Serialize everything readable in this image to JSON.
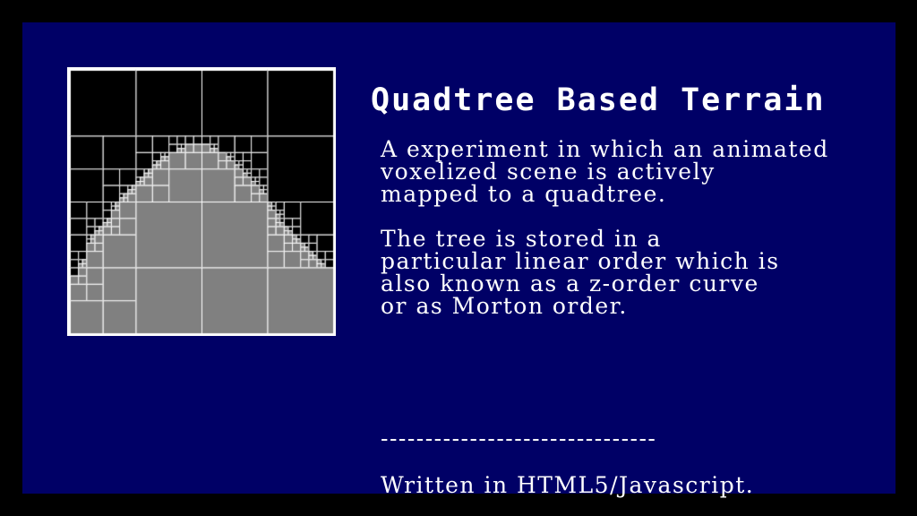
{
  "title": "Quadtree Based Terrain",
  "paragraphs": [
    {
      "lines": [
        "A experiment in which an animated",
        "voxelized scene is actively",
        "mapped to a quadtree."
      ]
    },
    {
      "lines": [
        "The tree is stored in a",
        "particular linear order which is",
        "also known as a z-order curve",
        "or as Morton order."
      ]
    }
  ],
  "divider": "-------------------------------",
  "credit": "Written in HTML5/Javascript.",
  "colors": {
    "outer_background": "#000000",
    "panel_background": "#000066",
    "text": "#ffffff",
    "empty_cell": "#000000",
    "filled_cell": "#808080",
    "cell_border": "#ffffff"
  },
  "visualization": {
    "type": "quadtree",
    "grid_resolution": 64,
    "terrain_heights": [
      14,
      14,
      17,
      18,
      22,
      24,
      25,
      26,
      27,
      28,
      30,
      32,
      33,
      34,
      35,
      36,
      37,
      38,
      39,
      40,
      41,
      42,
      43,
      43,
      44,
      44,
      45,
      45,
      46,
      46,
      46,
      46,
      46,
      46,
      45,
      45,
      44,
      44,
      43,
      42,
      41,
      40,
      39,
      38,
      37,
      36,
      35,
      34,
      32,
      30,
      29,
      27,
      26,
      25,
      24,
      23,
      22,
      21,
      20,
      19,
      18,
      17,
      16,
      16
    ]
  }
}
